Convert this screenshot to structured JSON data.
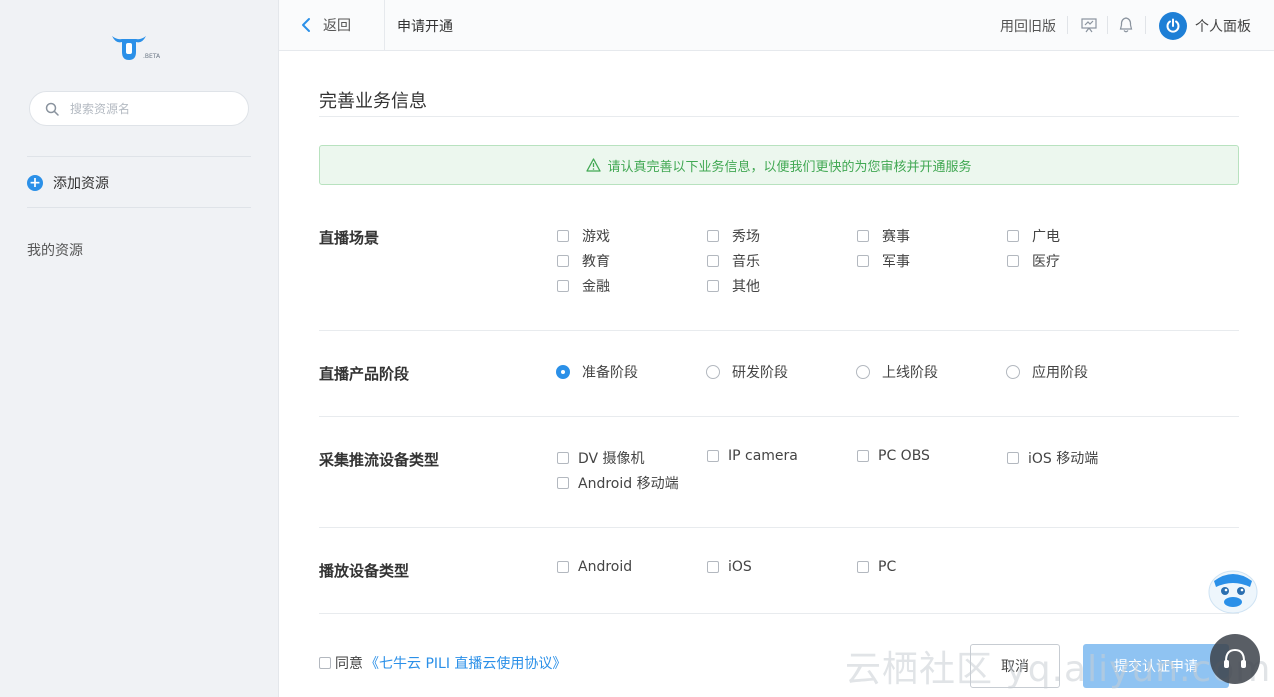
{
  "sidebar": {
    "logo_badge": ".BETA",
    "search_placeholder": "搜索资源名",
    "add_resource": "添加资源",
    "my_resources": "我的资源"
  },
  "topbar": {
    "back": "返回",
    "title": "申请开通",
    "old_version": "用回旧版",
    "panel": "个人面板"
  },
  "form": {
    "section_title": "完善业务信息",
    "notice": "请认真完善以下业务信息，以便我们更快的为您审核并开通服务",
    "live_scene": {
      "label": "直播场景",
      "options": [
        "游戏",
        "秀场",
        "赛事",
        "广电",
        "教育",
        "音乐",
        "军事",
        "医疗",
        "金融",
        "其他"
      ]
    },
    "product_stage": {
      "label": "直播产品阶段",
      "options": [
        "准备阶段",
        "研发阶段",
        "上线阶段",
        "应用阶段"
      ],
      "selected": "准备阶段"
    },
    "capture_device": {
      "label": "采集推流设备类型",
      "options": [
        "DV 摄像机",
        "IP camera",
        "PC OBS",
        "iOS 移动端",
        "Android 移动端"
      ]
    },
    "playback_device": {
      "label": "播放设备类型",
      "options": [
        "Android",
        "iOS",
        "PC"
      ]
    },
    "agree_prefix": "同意",
    "agreement_link": "《七牛云 PILI 直播云使用协议》",
    "cancel": "取消",
    "submit": "提交认证申请"
  },
  "watermark": "云栖社区 yq.aliyun.com",
  "colors": {
    "accent": "#2b90e8",
    "success": "#41a853",
    "sidebar_bg": "#f0f2f5"
  }
}
